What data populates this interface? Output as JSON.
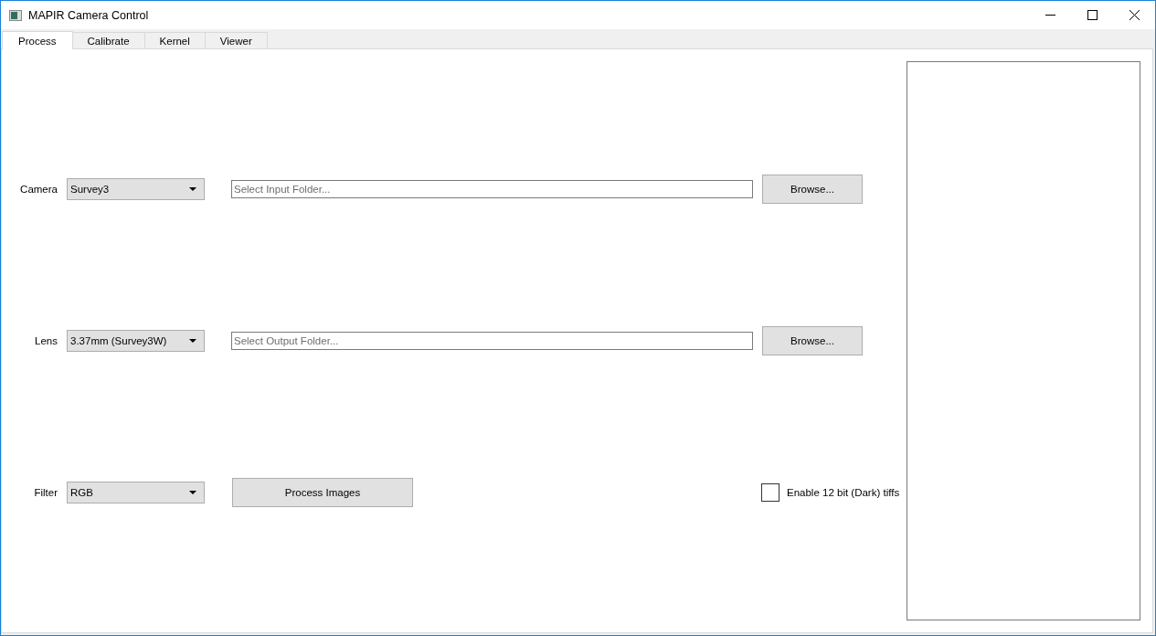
{
  "window": {
    "title": "MAPIR Camera Control"
  },
  "tabs": [
    {
      "label": "Process",
      "selected": true
    },
    {
      "label": "Calibrate",
      "selected": false
    },
    {
      "label": "Kernel",
      "selected": false
    },
    {
      "label": "Viewer",
      "selected": false
    }
  ],
  "rows": [
    {
      "kind": "folder",
      "label": "Camera",
      "combo": "Survey3",
      "placeholder": "Select Input Folder...",
      "button": "Browse..."
    },
    {
      "kind": "folder",
      "label": "Lens",
      "combo": "3.37mm (Survey3W)",
      "placeholder": "Select Output Folder...",
      "button": "Browse..."
    },
    {
      "kind": "action",
      "label": "Filter",
      "combo": "RGB",
      "button": "Process Images",
      "checkbox": {
        "label": "Enable 12 bit (Dark) tiffs",
        "checked": false
      }
    }
  ]
}
